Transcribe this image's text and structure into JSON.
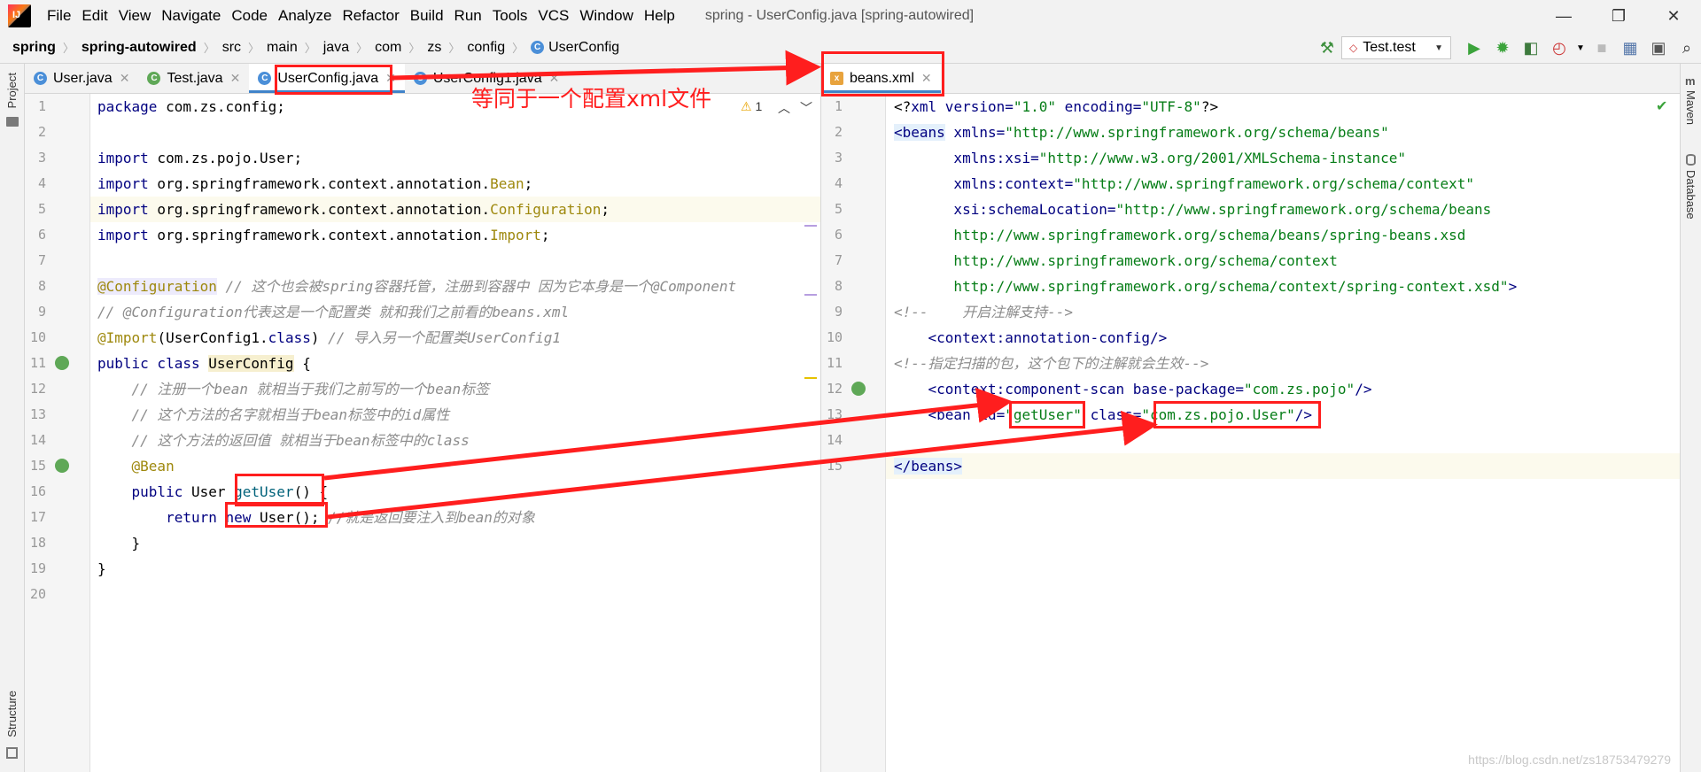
{
  "window": {
    "title": "spring - UserConfig.java [spring-autowired]",
    "menu": [
      "File",
      "Edit",
      "View",
      "Navigate",
      "Code",
      "Analyze",
      "Refactor",
      "Build",
      "Run",
      "Tools",
      "VCS",
      "Window",
      "Help"
    ]
  },
  "breadcrumb": [
    "spring",
    "spring-autowired",
    "src",
    "main",
    "java",
    "com",
    "zs",
    "config",
    "UserConfig"
  ],
  "run_config": "Test.test",
  "side_tools": {
    "project": "Project",
    "structure": "Structure",
    "maven": "Maven",
    "database": "Database"
  },
  "left_tabs": [
    {
      "label": "User.java"
    },
    {
      "label": "Test.java"
    },
    {
      "label": "UserConfig.java"
    },
    {
      "label": "UserConfig1.java"
    }
  ],
  "right_tabs": [
    {
      "label": "beans.xml"
    }
  ],
  "warning_count": "1",
  "annotation_text": "等同于一个配置xml文件",
  "left_code": {
    "line_numbers": [
      "1",
      "2",
      "3",
      "4",
      "5",
      "6",
      "7",
      "8",
      "9",
      "10",
      "11",
      "12",
      "13",
      "14",
      "15",
      "16",
      "17",
      "18",
      "19",
      "20"
    ],
    "l1_kw": "package",
    "l1_rest": " com.zs.config;",
    "l3_kw": "import",
    "l3_rest": " com.zs.pojo.User;",
    "l4_kw": "import",
    "l4_rest": " org.springframework.context.annotation.",
    "l4_cls": "Bean",
    "l4_end": ";",
    "l5_kw": "import",
    "l5_rest": " org.springframework.context.annotation.",
    "l5_cls": "Configuration",
    "l5_end": ";",
    "l6_kw": "import",
    "l6_rest": " org.springframework.context.annotation.",
    "l6_cls": "Import",
    "l6_end": ";",
    "l8_an": "@Configuration",
    "l8_cm": " // 这个也会被spring容器托管，注册到容器中 因为它本身是一个@Component",
    "l9_cm": "// @Configuration代表这是一个配置类 就和我们之前看的beans.xml",
    "l10_an": "@Import",
    "l10_a": "(UserConfig1.",
    "l10_kw": "class",
    "l10_b": ")",
    "l10_cm": " // 导入另一个配置类UserConfig1",
    "l11_kw": "public class",
    "l11_sp": " ",
    "l11_cls": "UserConfig",
    "l11_end": " {",
    "l12_cm": "    // 注册一个bean 就相当于我们之前写的一个bean标签",
    "l13_cm": "    // 这个方法的名字就相当于bean标签中的id属性",
    "l14_cm": "    // 这个方法的返回值 就相当于bean标签中的class",
    "l15_an": "    @Bean",
    "l16_kw": "    public",
    "l16_a": " User ",
    "l16_m": "getUser",
    "l16_b": "() {",
    "l17_kw": "        return",
    "l17_sp": " ",
    "l17_kw2": "new",
    "l17_a": " User();",
    "l17_cm": " //就是返回要注入到bean的对象",
    "l18": "    }",
    "l19": "}"
  },
  "right_code": {
    "line_numbers": [
      "1",
      "2",
      "3",
      "4",
      "5",
      "6",
      "7",
      "8",
      "9",
      "10",
      "11",
      "12",
      "13",
      "14",
      "15"
    ],
    "l1_a": "<?",
    "l1_tag": "xml",
    "l1_attr1": " version=",
    "l1_v1": "\"1.0\"",
    "l1_attr2": " encoding=",
    "l1_v2": "\"UTF-8\"",
    "l1_b": "?>",
    "l2_tag": "<beans",
    "l2_attr": " xmlns=",
    "l2_v": "\"http://www.springframework.org/schema/beans\"",
    "l3_attr": "       xmlns:xsi=",
    "l3_v": "\"http://www.w3.org/2001/XMLSchema-instance\"",
    "l4_attr": "       xmlns:context=",
    "l4_v": "\"http://www.springframework.org/schema/context\"",
    "l5_attr": "       xsi:schemaLocation=",
    "l5_v": "\"http://www.springframework.org/schema/beans",
    "l6_v": "       http://www.springframework.org/schema/beans/spring-beans.xsd",
    "l7_v": "       http://www.springframework.org/schema/context",
    "l8_v": "       http://www.springframework.org/schema/context/spring-context.xsd\"",
    "l8_end": ">",
    "l9_cm": "<!--    开启注解支持-->",
    "l10_tag": "    <context:annotation-config/>",
    "l11_cm": "<!--指定扫描的包，这个包下的注解就会生效-->",
    "l12_tag": "    <context:component-scan",
    "l12_attr": " base-package=",
    "l12_v": "\"com.zs.pojo\"",
    "l12_end": "/>",
    "l13_tag": "    <bean",
    "l13_attr1": " id=",
    "l13_v1": "\"getUser\"",
    "l13_attr2": " class=",
    "l13_v2": "\"com.zs.pojo.User\"",
    "l13_end": "/>",
    "l15_tag": "</beans>"
  },
  "watermark": "https://blog.csdn.net/zs18753479279"
}
